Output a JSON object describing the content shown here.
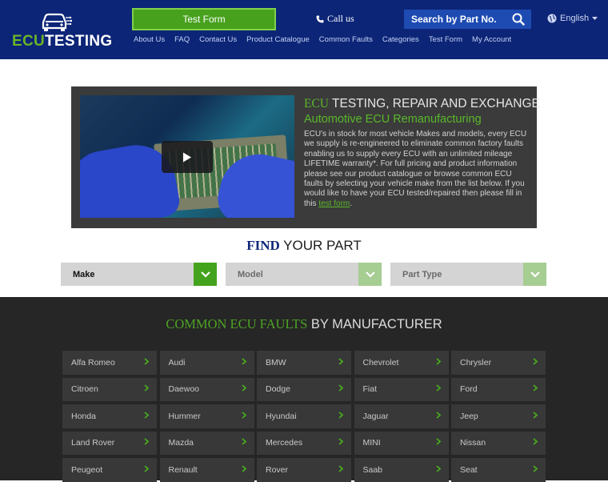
{
  "header": {
    "logo": {
      "prefix": "ECU",
      "suffix": "TESTING"
    },
    "test_form_label": "Test Form",
    "call_us_label": "Call us",
    "search_placeholder": "Search by Part No.",
    "language_label": "English",
    "nav": [
      "About Us",
      "FAQ",
      "Contact Us",
      "Product Catalogue",
      "Common Faults",
      "Categories",
      "Test Form",
      "My Account"
    ]
  },
  "hero": {
    "title_accent": "ECU",
    "title_rest": " TESTING, REPAIR AND EXCHANGE",
    "subtitle": "Automotive ECU Remanufacturing",
    "body": "ECU's in stock for most vehicle Makes and models, every ECU we supply is re-engineered to eliminate common factory faults enabling us to supply every ECU with an unlimited mileage LIFETIME warranty*. For full pricing and product information please see our product catalogue or browse common ECU faults by selecting your vehicle make from the list below. If you would like to have your ECU tested/repaired then please fill in this ",
    "link_text": "test form",
    "body_end": "."
  },
  "finder": {
    "title_accent": "FIND",
    "title_rest": " YOUR PART",
    "make_label": "Make",
    "model_label": "Model",
    "type_label": "Part Type"
  },
  "faults": {
    "title_accent": "COMMON ECU FAULTS",
    "title_rest": " BY MANUFACTURER",
    "makes": [
      "Alfa Romeo",
      "Audi",
      "BMW",
      "Chevrolet",
      "Chrysler",
      "Citroen",
      "Daewoo",
      "Dodge",
      "Fiat",
      "Ford",
      "Honda",
      "Hummer",
      "Hyundai",
      "Jaguar",
      "Jeep",
      "Land Rover",
      "Mazda",
      "Mercedes",
      "MINI",
      "Nissan",
      "Peugeot",
      "Renault",
      "Rover",
      "Saab",
      "Seat"
    ]
  },
  "colors": {
    "header_bg": "#0c2577",
    "accent_green": "#47a11d",
    "faults_bg": "#262626"
  }
}
